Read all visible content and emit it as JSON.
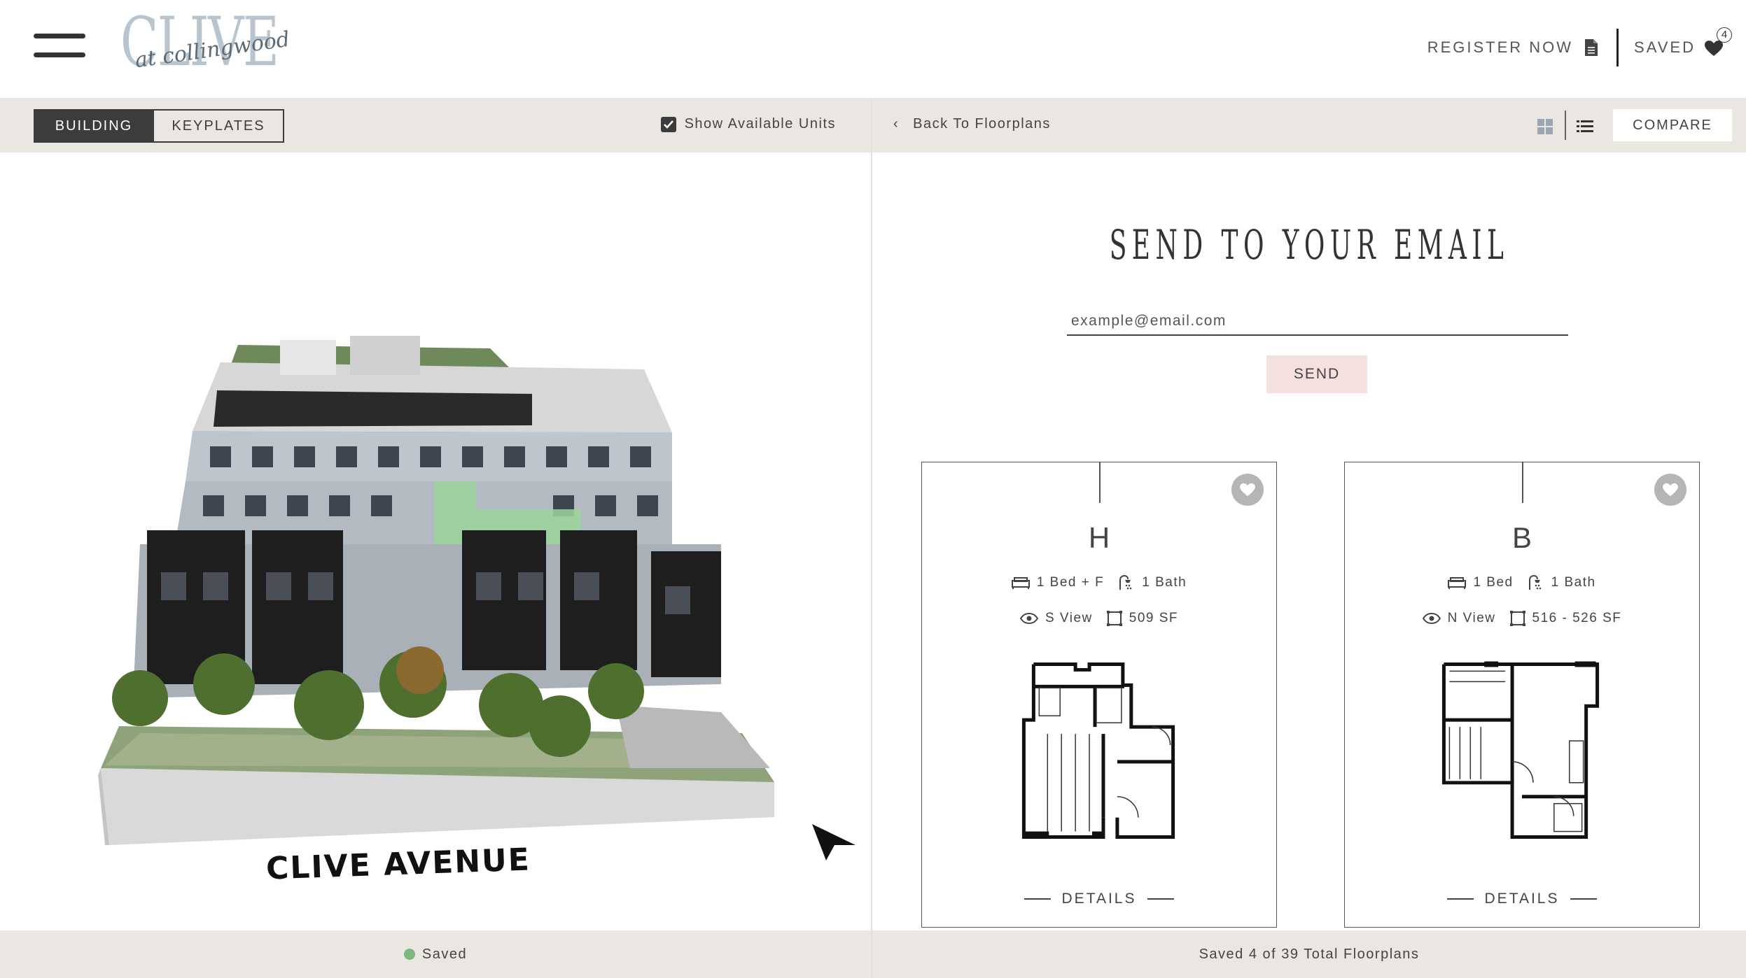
{
  "header": {
    "logo_text": "CLIVE",
    "logo_script": "at collingwood",
    "register_label": "REGISTER NOW",
    "saved_label": "SAVED",
    "saved_count": "4"
  },
  "left_toolbar": {
    "tab_building": "BUILDING",
    "tab_keyplates": "KEYPLATES",
    "show_available_label": "Show Available Units",
    "show_available_checked": true
  },
  "right_toolbar": {
    "back_label": "Back To Floorplans",
    "compare_label": "COMPARE"
  },
  "building": {
    "street_label": "CLIVE AVENUE"
  },
  "email": {
    "title": "SEND TO YOUR EMAIL",
    "placeholder": "example@email.com",
    "send_label": "SEND"
  },
  "cards": [
    {
      "unit": "H",
      "beds": "1 Bed + F",
      "baths": "1 Bath",
      "view": "S View",
      "area": "509 SF",
      "details_label": "DETAILS"
    },
    {
      "unit": "B",
      "beds": "1 Bed",
      "baths": "1 Bath",
      "view": "N View",
      "area": "516 - 526 SF",
      "details_label": "DETAILS"
    }
  ],
  "footer": {
    "left_status": "Saved",
    "right_status": "Saved 4 of 39 Total Floorplans"
  },
  "colors": {
    "toolbar_bg": "#eae6e1",
    "active_tab_bg": "#3c3c3c",
    "send_bg": "#f4e0df",
    "saved_dot": "#7cb77e",
    "highlight_unit": "#9bd49b"
  }
}
